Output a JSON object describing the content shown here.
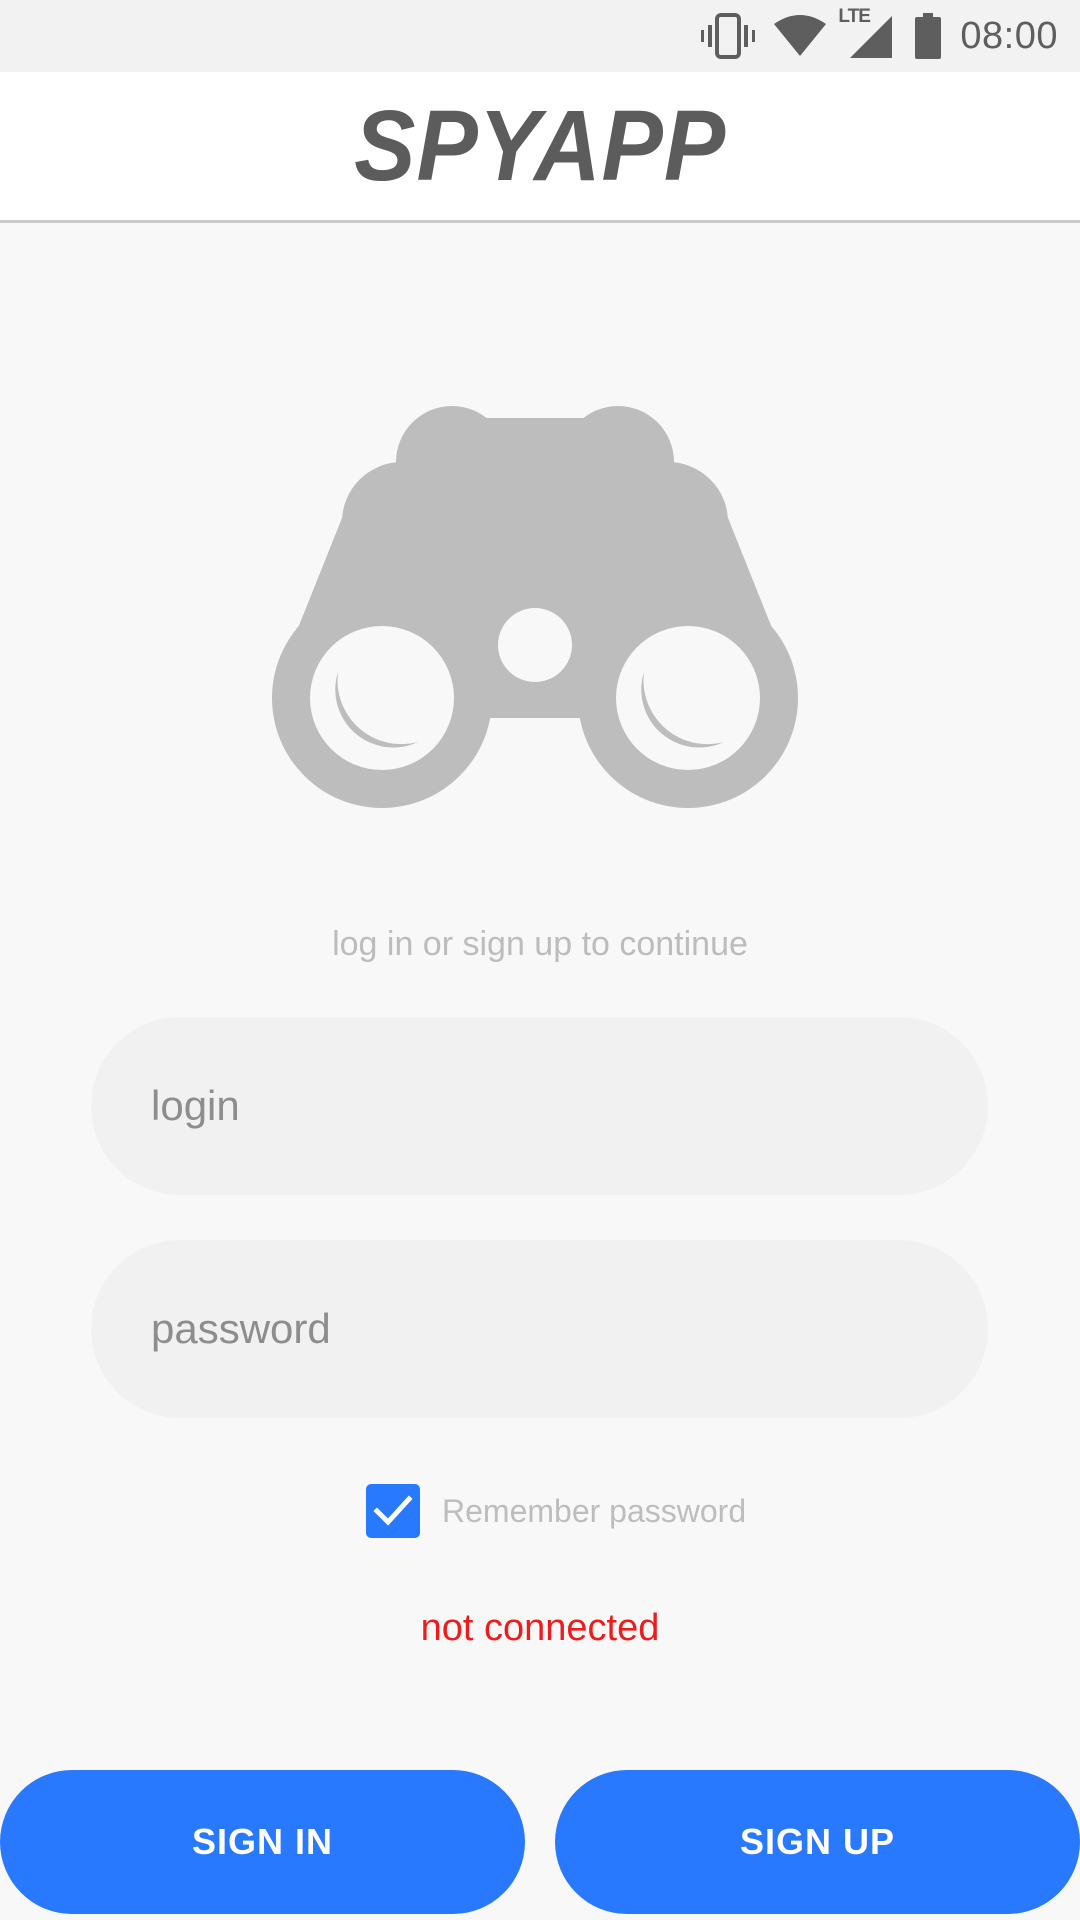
{
  "status_bar": {
    "time": "08:00",
    "network_label": "LTE",
    "icons": [
      "vibrate-icon",
      "wifi-icon",
      "cell-signal-icon",
      "battery-icon"
    ]
  },
  "app_bar": {
    "title": "SPYAPP"
  },
  "logo": {
    "icon": "binoculars-icon",
    "color": "#bdbdbd"
  },
  "subtitle": "log in or sign up to continue",
  "login_field": {
    "placeholder": "login",
    "value": ""
  },
  "password_field": {
    "placeholder": "password",
    "value": ""
  },
  "remember": {
    "label": "Remember password",
    "checked": true
  },
  "connection_status": {
    "text": "not connected",
    "color": "#ee1c1c"
  },
  "buttons": {
    "sign_in": "SIGN IN",
    "sign_up": "SIGN UP"
  },
  "colors": {
    "accent": "#2979ff",
    "background": "#f8f8f8",
    "field_background": "#f1f1f1"
  }
}
